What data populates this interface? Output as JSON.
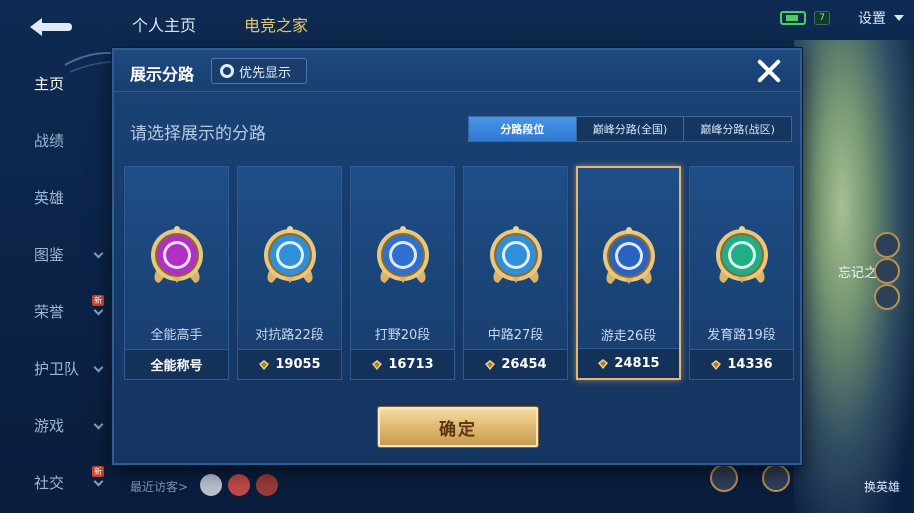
{
  "top_tabs": [
    "个人主页",
    "电竞之家"
  ],
  "top_right": {
    "status_chip": "7",
    "settings_label": "设置"
  },
  "sidebar": {
    "items": [
      {
        "label": "主页",
        "active": true,
        "has_chevron": false
      },
      {
        "label": "战绩",
        "active": false,
        "has_chevron": false
      },
      {
        "label": "英雄",
        "active": false,
        "has_chevron": false
      },
      {
        "label": "图鉴",
        "active": false,
        "has_chevron": true
      },
      {
        "label": "荣誉",
        "active": false,
        "has_chevron": true,
        "new": "新"
      },
      {
        "label": "护卫队",
        "active": false,
        "has_chevron": true
      },
      {
        "label": "游戏",
        "active": false,
        "has_chevron": true
      },
      {
        "label": "社交",
        "active": false,
        "has_chevron": true,
        "new": "新"
      }
    ]
  },
  "background": {
    "art_text": "忘记之石",
    "switch_label": "换英雄"
  },
  "visitors_label": "最近访客>",
  "modal": {
    "title": "展示分路",
    "priority_label": "优先显示",
    "subtitle": "请选择展示的分路",
    "tabs": [
      {
        "label": "分路段位",
        "active": true
      },
      {
        "label": "巅峰分路(全国)",
        "active": false
      },
      {
        "label": "巅峰分路(战区)",
        "active": false
      }
    ],
    "cards": [
      {
        "name": "全能高手",
        "footer": "全能称号",
        "badge": "all-round-badge-icon",
        "color": "#b02fc4",
        "selected": false,
        "has_rank_icon": false
      },
      {
        "name": "对抗路22段",
        "footer": "19055",
        "badge": "clash-lane-badge-icon",
        "color": "#2f8fd8",
        "selected": false,
        "has_rank_icon": true
      },
      {
        "name": "打野20段",
        "footer": "16713",
        "badge": "jungle-badge-icon",
        "color": "#2f6fd0",
        "selected": false,
        "has_rank_icon": true
      },
      {
        "name": "中路27段",
        "footer": "26454",
        "badge": "mid-lane-badge-icon",
        "color": "#2f8fd8",
        "selected": false,
        "has_rank_icon": true
      },
      {
        "name": "游走26段",
        "footer": "24815",
        "badge": "roam-badge-icon",
        "color": "#2a63bf",
        "selected": true,
        "has_rank_icon": true
      },
      {
        "name": "发育路19段",
        "footer": "14336",
        "badge": "farm-lane-badge-icon",
        "color": "#1fae86",
        "selected": false,
        "has_rank_icon": true
      }
    ],
    "confirm_label": "确定"
  }
}
